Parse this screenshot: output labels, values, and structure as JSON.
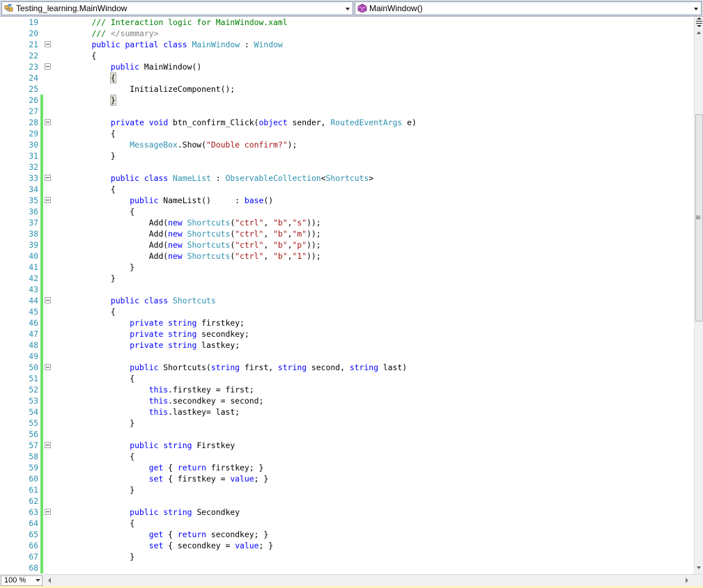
{
  "navbar": {
    "type_combo": "Testing_learning.MainWindow",
    "member_combo": "MainWindow()",
    "type_icon": "class-icon",
    "member_icon": "method-icon"
  },
  "colors": {
    "keyword": "#0000ff",
    "type": "#2b91af",
    "string": "#a31515",
    "comment": "#008000",
    "line_number": "#2b91af",
    "saved_change": "#6ce26c"
  },
  "code_lines": [
    {
      "n": "19",
      "t": [
        [
          "    ",
          ""
        ],
        [
          "/// Interaction logic for MainWindow.xaml",
          "cm"
        ]
      ]
    },
    {
      "n": "20",
      "t": [
        [
          "    ",
          ""
        ],
        [
          "/// ",
          "cm"
        ],
        [
          "</summary>",
          "xd"
        ]
      ]
    },
    {
      "n": "21",
      "t": [
        [
          "    ",
          ""
        ],
        [
          "public",
          "kw"
        ],
        [
          " ",
          ""
        ],
        [
          "partial",
          "kw"
        ],
        [
          " ",
          ""
        ],
        [
          "class",
          "kw"
        ],
        [
          " ",
          ""
        ],
        [
          "MainWindow",
          "ty"
        ],
        [
          " : ",
          ""
        ],
        [
          "Window",
          "ty"
        ]
      ]
    },
    {
      "n": "22",
      "t": [
        [
          "    {",
          ""
        ]
      ]
    },
    {
      "n": "23",
      "t": [
        [
          "        ",
          ""
        ],
        [
          "public",
          "kw"
        ],
        [
          " MainWindow()",
          ""
        ]
      ]
    },
    {
      "n": "24",
      "t": [
        [
          "        ",
          ""
        ],
        [
          "{",
          "hl"
        ]
      ]
    },
    {
      "n": "25",
      "t": [
        [
          "            InitializeComponent();",
          ""
        ]
      ]
    },
    {
      "n": "26",
      "t": [
        [
          "        ",
          ""
        ],
        [
          "}",
          "hl"
        ]
      ]
    },
    {
      "n": "27",
      "t": []
    },
    {
      "n": "28",
      "t": [
        [
          "        ",
          ""
        ],
        [
          "private",
          "kw"
        ],
        [
          " ",
          ""
        ],
        [
          "void",
          "kw"
        ],
        [
          " btn_confirm_Click(",
          ""
        ],
        [
          "object",
          "kw"
        ],
        [
          " sender, ",
          ""
        ],
        [
          "RoutedEventArgs",
          "ty"
        ],
        [
          " e)",
          ""
        ]
      ]
    },
    {
      "n": "29",
      "t": [
        [
          "        {",
          ""
        ]
      ]
    },
    {
      "n": "30",
      "t": [
        [
          "            ",
          ""
        ],
        [
          "MessageBox",
          "ty"
        ],
        [
          ".Show(",
          ""
        ],
        [
          "\"Double confirm?\"",
          "str"
        ],
        [
          ");",
          ""
        ]
      ]
    },
    {
      "n": "31",
      "t": [
        [
          "        }",
          ""
        ]
      ]
    },
    {
      "n": "32",
      "t": []
    },
    {
      "n": "33",
      "t": [
        [
          "        ",
          ""
        ],
        [
          "public",
          "kw"
        ],
        [
          " ",
          ""
        ],
        [
          "class",
          "kw"
        ],
        [
          " ",
          ""
        ],
        [
          "NameList",
          "ty"
        ],
        [
          " : ",
          ""
        ],
        [
          "ObservableCollection",
          "ty"
        ],
        [
          "<",
          ""
        ],
        [
          "Shortcuts",
          "ty"
        ],
        [
          ">",
          ""
        ]
      ]
    },
    {
      "n": "34",
      "t": [
        [
          "        {",
          ""
        ]
      ]
    },
    {
      "n": "35",
      "t": [
        [
          "            ",
          ""
        ],
        [
          "public",
          "kw"
        ],
        [
          " NameList()     : ",
          ""
        ],
        [
          "base",
          "kw"
        ],
        [
          "()",
          ""
        ]
      ]
    },
    {
      "n": "36",
      "t": [
        [
          "            {",
          ""
        ]
      ]
    },
    {
      "n": "37",
      "t": [
        [
          "                Add(",
          ""
        ],
        [
          "new",
          "kw"
        ],
        [
          " ",
          ""
        ],
        [
          "Shortcuts",
          "ty"
        ],
        [
          "(",
          ""
        ],
        [
          "\"ctrl\"",
          "str"
        ],
        [
          ", ",
          ""
        ],
        [
          "\"b\"",
          "str"
        ],
        [
          ",",
          ""
        ],
        [
          "\"s\"",
          "str"
        ],
        [
          "));",
          ""
        ]
      ]
    },
    {
      "n": "38",
      "t": [
        [
          "                Add(",
          ""
        ],
        [
          "new",
          "kw"
        ],
        [
          " ",
          ""
        ],
        [
          "Shortcuts",
          "ty"
        ],
        [
          "(",
          ""
        ],
        [
          "\"ctrl\"",
          "str"
        ],
        [
          ", ",
          ""
        ],
        [
          "\"b\"",
          "str"
        ],
        [
          ",",
          ""
        ],
        [
          "\"m\"",
          "str"
        ],
        [
          "));",
          ""
        ]
      ]
    },
    {
      "n": "39",
      "t": [
        [
          "                Add(",
          ""
        ],
        [
          "new",
          "kw"
        ],
        [
          " ",
          ""
        ],
        [
          "Shortcuts",
          "ty"
        ],
        [
          "(",
          ""
        ],
        [
          "\"ctrl\"",
          "str"
        ],
        [
          ", ",
          ""
        ],
        [
          "\"b\"",
          "str"
        ],
        [
          ",",
          ""
        ],
        [
          "\"p\"",
          "str"
        ],
        [
          "));",
          ""
        ]
      ]
    },
    {
      "n": "40",
      "t": [
        [
          "                Add(",
          ""
        ],
        [
          "new",
          "kw"
        ],
        [
          " ",
          ""
        ],
        [
          "Shortcuts",
          "ty"
        ],
        [
          "(",
          ""
        ],
        [
          "\"ctrl\"",
          "str"
        ],
        [
          ", ",
          ""
        ],
        [
          "\"b\"",
          "str"
        ],
        [
          ",",
          ""
        ],
        [
          "\"1\"",
          "str"
        ],
        [
          "));",
          ""
        ]
      ]
    },
    {
      "n": "41",
      "t": [
        [
          "            }",
          ""
        ]
      ]
    },
    {
      "n": "42",
      "t": [
        [
          "        }",
          ""
        ]
      ]
    },
    {
      "n": "43",
      "t": []
    },
    {
      "n": "44",
      "t": [
        [
          "        ",
          ""
        ],
        [
          "public",
          "kw"
        ],
        [
          " ",
          ""
        ],
        [
          "class",
          "kw"
        ],
        [
          " ",
          ""
        ],
        [
          "Shortcuts",
          "ty"
        ]
      ]
    },
    {
      "n": "45",
      "t": [
        [
          "        {",
          ""
        ]
      ]
    },
    {
      "n": "46",
      "t": [
        [
          "            ",
          ""
        ],
        [
          "private",
          "kw"
        ],
        [
          " ",
          ""
        ],
        [
          "string",
          "kw"
        ],
        [
          " firstkey;",
          ""
        ]
      ]
    },
    {
      "n": "47",
      "t": [
        [
          "            ",
          ""
        ],
        [
          "private",
          "kw"
        ],
        [
          " ",
          ""
        ],
        [
          "string",
          "kw"
        ],
        [
          " secondkey;",
          ""
        ]
      ]
    },
    {
      "n": "48",
      "t": [
        [
          "            ",
          ""
        ],
        [
          "private",
          "kw"
        ],
        [
          " ",
          ""
        ],
        [
          "string",
          "kw"
        ],
        [
          " lastkey;",
          ""
        ]
      ]
    },
    {
      "n": "49",
      "t": []
    },
    {
      "n": "50",
      "t": [
        [
          "            ",
          ""
        ],
        [
          "public",
          "kw"
        ],
        [
          " Shortcuts(",
          ""
        ],
        [
          "string",
          "kw"
        ],
        [
          " first, ",
          ""
        ],
        [
          "string",
          "kw"
        ],
        [
          " second, ",
          ""
        ],
        [
          "string",
          "kw"
        ],
        [
          " last)",
          ""
        ]
      ]
    },
    {
      "n": "51",
      "t": [
        [
          "            {",
          ""
        ]
      ]
    },
    {
      "n": "52",
      "t": [
        [
          "                ",
          ""
        ],
        [
          "this",
          "kw"
        ],
        [
          ".firstkey = first;",
          ""
        ]
      ]
    },
    {
      "n": "53",
      "t": [
        [
          "                ",
          ""
        ],
        [
          "this",
          "kw"
        ],
        [
          ".secondkey = second;",
          ""
        ]
      ]
    },
    {
      "n": "54",
      "t": [
        [
          "                ",
          ""
        ],
        [
          "this",
          "kw"
        ],
        [
          ".lastkey= last;",
          ""
        ]
      ]
    },
    {
      "n": "55",
      "t": [
        [
          "            }",
          ""
        ]
      ]
    },
    {
      "n": "56",
      "t": []
    },
    {
      "n": "57",
      "t": [
        [
          "            ",
          ""
        ],
        [
          "public",
          "kw"
        ],
        [
          " ",
          ""
        ],
        [
          "string",
          "kw"
        ],
        [
          " Firstkey",
          ""
        ]
      ]
    },
    {
      "n": "58",
      "t": [
        [
          "            {",
          ""
        ]
      ]
    },
    {
      "n": "59",
      "t": [
        [
          "                ",
          ""
        ],
        [
          "get",
          "kw"
        ],
        [
          " { ",
          ""
        ],
        [
          "return",
          "kw"
        ],
        [
          " firstkey; }",
          ""
        ]
      ]
    },
    {
      "n": "60",
      "t": [
        [
          "                ",
          ""
        ],
        [
          "set",
          "kw"
        ],
        [
          " { firstkey = ",
          ""
        ],
        [
          "value",
          "kw"
        ],
        [
          "; }",
          ""
        ]
      ]
    },
    {
      "n": "61",
      "t": [
        [
          "            }",
          ""
        ]
      ]
    },
    {
      "n": "62",
      "t": []
    },
    {
      "n": "63",
      "t": [
        [
          "            ",
          ""
        ],
        [
          "public",
          "kw"
        ],
        [
          " ",
          ""
        ],
        [
          "string",
          "kw"
        ],
        [
          " Secondkey",
          ""
        ]
      ]
    },
    {
      "n": "64",
      "t": [
        [
          "            {",
          ""
        ]
      ]
    },
    {
      "n": "65",
      "t": [
        [
          "                ",
          ""
        ],
        [
          "get",
          "kw"
        ],
        [
          " { ",
          ""
        ],
        [
          "return",
          "kw"
        ],
        [
          " secondkey; }",
          ""
        ]
      ]
    },
    {
      "n": "66",
      "t": [
        [
          "                ",
          ""
        ],
        [
          "set",
          "kw"
        ],
        [
          " { secondkey = ",
          ""
        ],
        [
          "value",
          "kw"
        ],
        [
          "; }",
          ""
        ]
      ]
    },
    {
      "n": "67",
      "t": [
        [
          "            }",
          ""
        ]
      ]
    },
    {
      "n": "68",
      "t": []
    }
  ],
  "statusbar": {
    "zoom": "100 %"
  }
}
